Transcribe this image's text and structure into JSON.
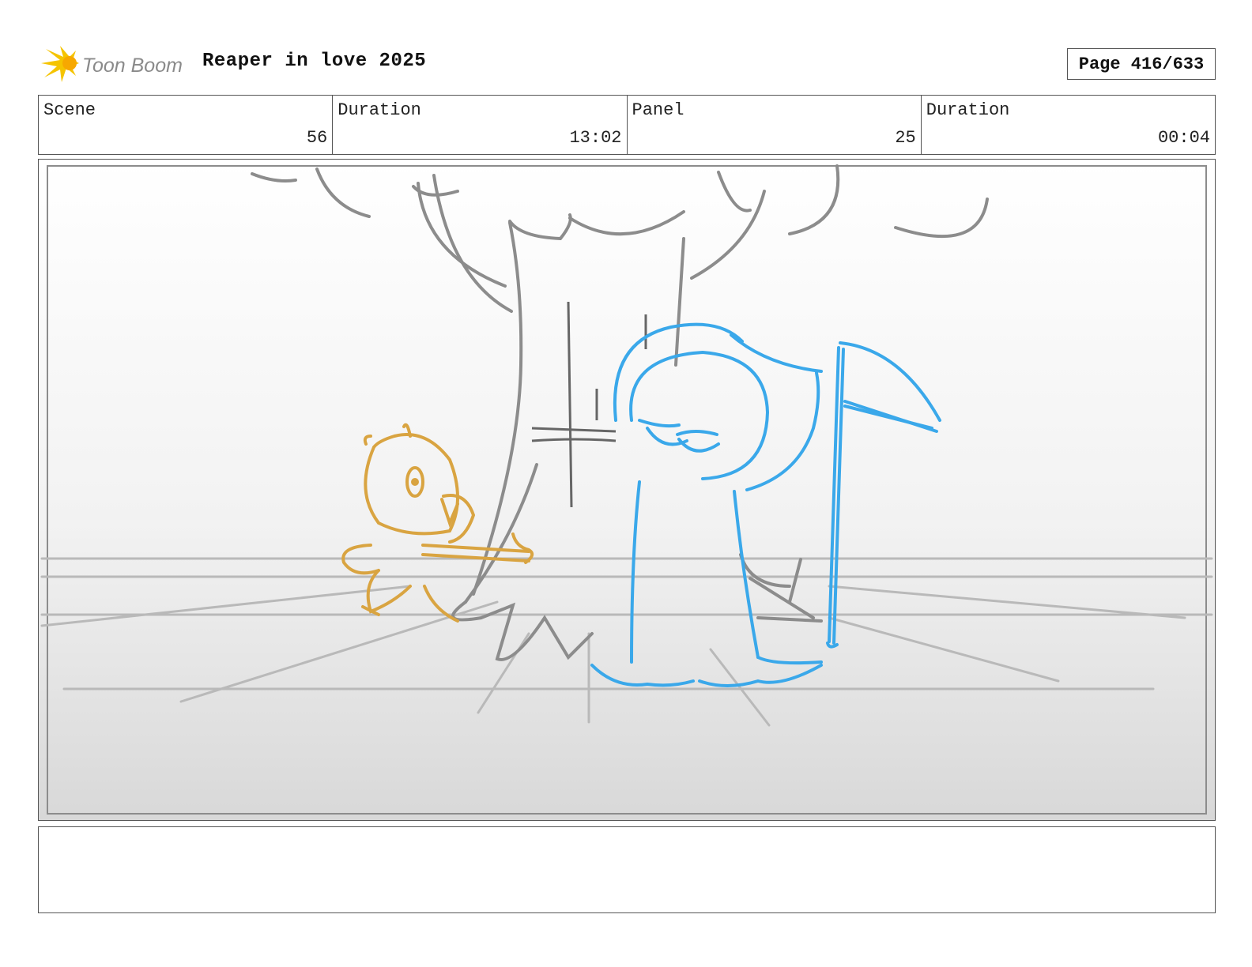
{
  "header": {
    "logo_text": "Toon Boom",
    "title": "Reaper in love 2025",
    "page": "Page 416/633"
  },
  "info": [
    {
      "label": "Scene",
      "value": "56"
    },
    {
      "label": "Duration",
      "value": "13:02"
    },
    {
      "label": "Panel",
      "value": "25"
    },
    {
      "label": "Duration",
      "value": "00:04"
    }
  ],
  "notes": "",
  "colors": {
    "logo_yellow": "#f5c400",
    "logo_gray": "#8a8a8a",
    "sketch_gray": "#8c8c8c",
    "reaper_blue": "#3aa8ea",
    "bird_orange": "#d9a441"
  }
}
